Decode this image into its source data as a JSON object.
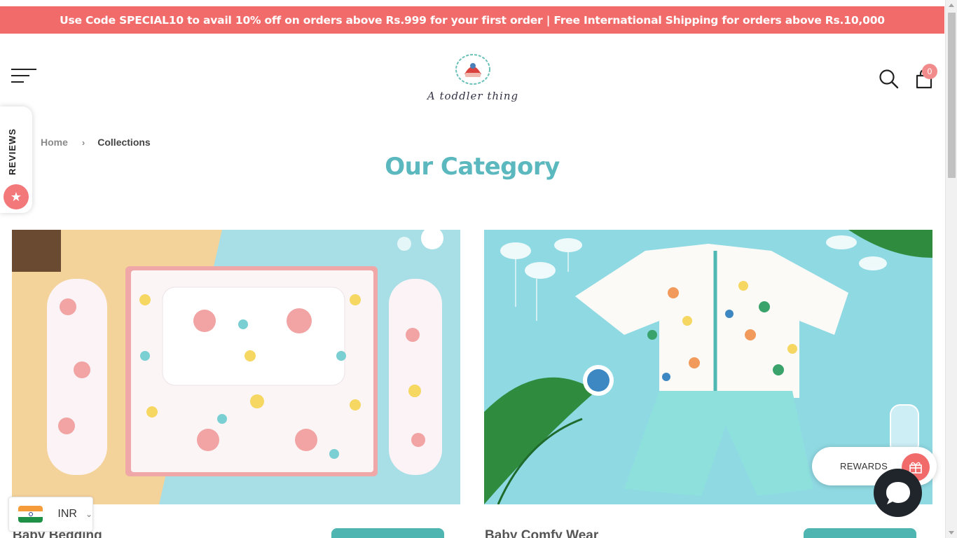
{
  "announcement": {
    "text": "Use Code SPECIAL10 to avail 10% off on orders above Rs.999 for your first order | Free International Shipping for orders above Rs.10,000"
  },
  "header": {
    "logo_text": "A toddler thing",
    "cart_count": "0",
    "icons": [
      "menu-icon",
      "search-icon",
      "cart-icon"
    ]
  },
  "reviews_tab": {
    "label": "REVIEWS",
    "icon": "star-icon"
  },
  "breadcrumb": {
    "home": "Home",
    "separator": "›",
    "current": "Collections"
  },
  "page_title": "Our Category",
  "categories": [
    {
      "title": "Baby Bedding",
      "image": "baby-bedding-photo"
    },
    {
      "title": "Baby Comfy Wear",
      "image": "baby-comfy-wear-photo"
    }
  ],
  "rewards": {
    "label": "REWARDS",
    "icon": "gift-icon"
  },
  "chat": {
    "icon": "chat-bubble-icon"
  },
  "currency": {
    "code": "INR",
    "flag": "india-flag-icon",
    "chevron": "⌄"
  },
  "colors": {
    "announcement_bg": "#f26b6b",
    "title_teal": "#5cb8bf",
    "button_teal": "#4fb5b1",
    "cart_badge": "#f28b8b",
    "chat_bg": "#1f252a"
  }
}
